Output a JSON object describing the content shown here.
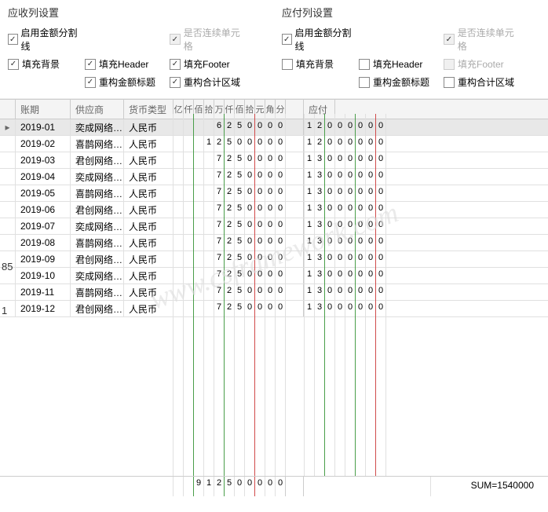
{
  "receivable_panel": {
    "title": "应收列设置",
    "cb_amount_split": "启用金额分割线",
    "cb_continuous": "是否连续单元格",
    "cb_fill_bg": "填充背景",
    "cb_fill_header": "填充Header",
    "cb_fill_footer": "填充Footer",
    "cb_rebuild_title": "重构金额标题",
    "cb_rebuild_sum": "重构合计区域"
  },
  "payable_panel": {
    "title": "应付列设置",
    "cb_amount_split": "启用金额分割线",
    "cb_continuous": "是否连续单元格",
    "cb_fill_bg": "填充背景",
    "cb_fill_header": "填充Header",
    "cb_fill_footer": "填充Footer",
    "cb_rebuild_title": "重构金额标题",
    "cb_rebuild_sum": "重构合计区域"
  },
  "headers": {
    "period": "账期",
    "supplier": "供应商",
    "currency": "货币类型",
    "digits": [
      "亿",
      "仟",
      "佰",
      "拾",
      "万",
      "仟",
      "佰",
      "拾",
      "元",
      "角",
      "分"
    ],
    "payable": "应付"
  },
  "rows": [
    {
      "period": "2019-01",
      "supplier": "奕成网络…",
      "currency": "人民币",
      "recv": [
        " ",
        " ",
        " ",
        " ",
        "6",
        "2",
        "5",
        "0",
        "0",
        "0",
        "0"
      ],
      "pay": [
        "1",
        "2",
        "0",
        "0",
        "0",
        "0",
        "0",
        "0"
      ]
    },
    {
      "period": "2019-02",
      "supplier": "喜鹊网络…",
      "currency": "人民币",
      "recv": [
        " ",
        " ",
        " ",
        "1",
        "2",
        "5",
        "0",
        "0",
        "0",
        "0",
        "0"
      ],
      "pay": [
        "1",
        "2",
        "0",
        "0",
        "0",
        "0",
        "0",
        "0"
      ]
    },
    {
      "period": "2019-03",
      "supplier": "君创网络…",
      "currency": "人民币",
      "recv": [
        " ",
        " ",
        " ",
        " ",
        "7",
        "2",
        "5",
        "0",
        "0",
        "0",
        "0"
      ],
      "pay": [
        "1",
        "3",
        "0",
        "0",
        "0",
        "0",
        "0",
        "0"
      ]
    },
    {
      "period": "2019-04",
      "supplier": "奕成网络…",
      "currency": "人民币",
      "recv": [
        " ",
        " ",
        " ",
        " ",
        "7",
        "2",
        "5",
        "0",
        "0",
        "0",
        "0"
      ],
      "pay": [
        "1",
        "3",
        "0",
        "0",
        "0",
        "0",
        "0",
        "0"
      ]
    },
    {
      "period": "2019-05",
      "supplier": "喜鹊网络…",
      "currency": "人民币",
      "recv": [
        " ",
        " ",
        " ",
        " ",
        "7",
        "2",
        "5",
        "0",
        "0",
        "0",
        "0"
      ],
      "pay": [
        "1",
        "3",
        "0",
        "0",
        "0",
        "0",
        "0",
        "0"
      ]
    },
    {
      "period": "2019-06",
      "supplier": "君创网络…",
      "currency": "人民币",
      "recv": [
        " ",
        " ",
        " ",
        " ",
        "7",
        "2",
        "5",
        "0",
        "0",
        "0",
        "0"
      ],
      "pay": [
        "1",
        "3",
        "0",
        "0",
        "0",
        "0",
        "0",
        "0"
      ]
    },
    {
      "period": "2019-07",
      "supplier": "奕成网络…",
      "currency": "人民币",
      "recv": [
        " ",
        " ",
        " ",
        " ",
        "7",
        "2",
        "5",
        "0",
        "0",
        "0",
        "0"
      ],
      "pay": [
        "1",
        "3",
        "0",
        "0",
        "0",
        "0",
        "0",
        "0"
      ]
    },
    {
      "period": "2019-08",
      "supplier": "喜鹊网络…",
      "currency": "人民币",
      "recv": [
        " ",
        " ",
        " ",
        " ",
        "7",
        "2",
        "5",
        "0",
        "0",
        "0",
        "0"
      ],
      "pay": [
        "1",
        "3",
        "0",
        "0",
        "0",
        "0",
        "0",
        "0"
      ]
    },
    {
      "period": "2019-09",
      "supplier": "君创网络…",
      "currency": "人民币",
      "recv": [
        " ",
        " ",
        " ",
        " ",
        "7",
        "2",
        "5",
        "0",
        "0",
        "0",
        "0"
      ],
      "pay": [
        "1",
        "3",
        "0",
        "0",
        "0",
        "0",
        "0",
        "0"
      ]
    },
    {
      "period": "2019-10",
      "supplier": "奕成网络…",
      "currency": "人民币",
      "recv": [
        " ",
        " ",
        " ",
        " ",
        "7",
        "2",
        "5",
        "0",
        "0",
        "0",
        "0"
      ],
      "pay": [
        "1",
        "3",
        "0",
        "0",
        "0",
        "0",
        "0",
        "0"
      ]
    },
    {
      "period": "2019-11",
      "supplier": "喜鹊网络…",
      "currency": "人民币",
      "recv": [
        " ",
        " ",
        " ",
        " ",
        "7",
        "2",
        "5",
        "0",
        "0",
        "0",
        "0"
      ],
      "pay": [
        "1",
        "3",
        "0",
        "0",
        "0",
        "0",
        "0",
        "0"
      ]
    },
    {
      "period": "2019-12",
      "supplier": "君创网络…",
      "currency": "人民币",
      "recv": [
        " ",
        " ",
        " ",
        " ",
        "7",
        "2",
        "5",
        "0",
        "0",
        "0",
        "0"
      ],
      "pay": [
        "1",
        "3",
        "0",
        "0",
        "0",
        "0",
        "0",
        "0"
      ]
    }
  ],
  "footer": {
    "digits": [
      " ",
      " ",
      "9",
      "1",
      "2",
      "5",
      "0",
      "0",
      "0",
      "0",
      "0"
    ],
    "sum_label": "SUM=1540000"
  },
  "left_labels": {
    "n85": "85",
    "n1": "1"
  },
  "watermark": "www.csframework.com"
}
